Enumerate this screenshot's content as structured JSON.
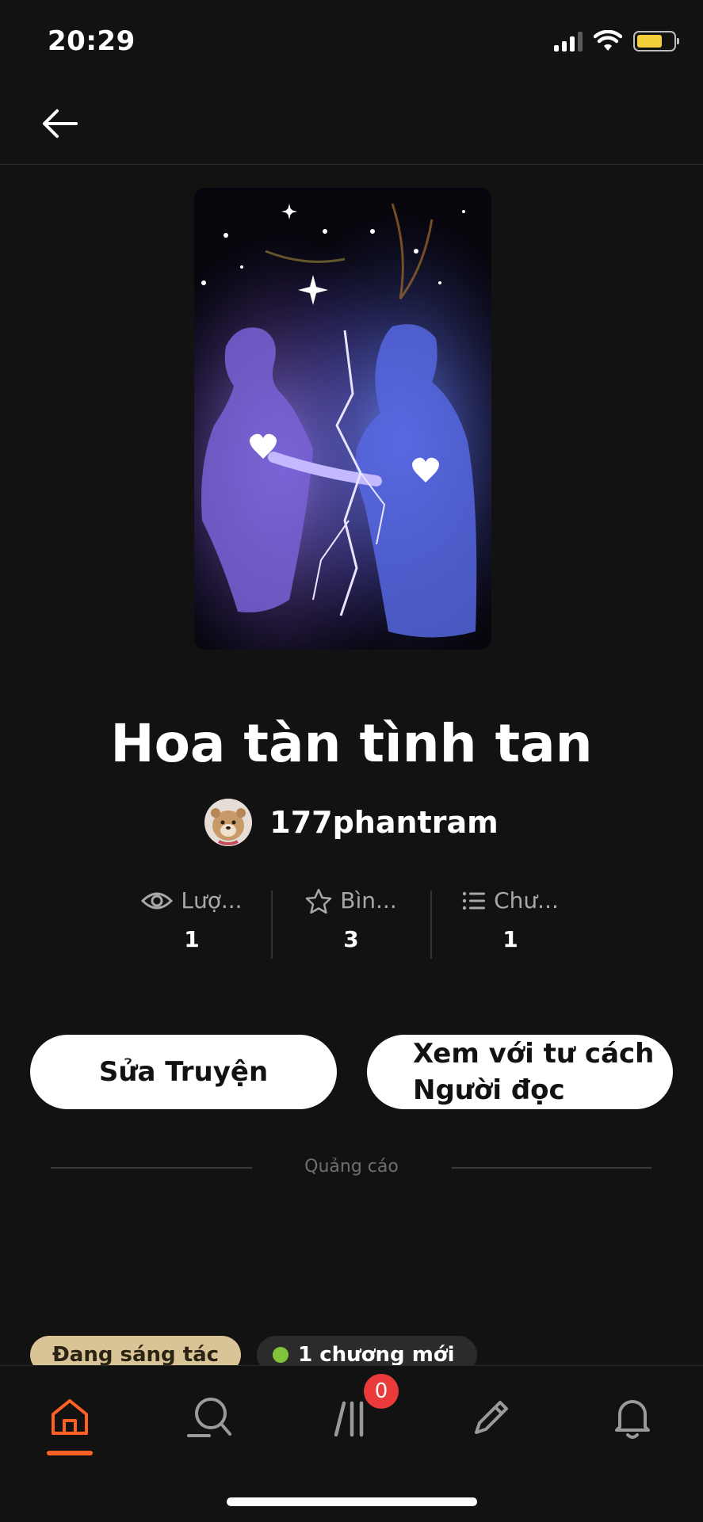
{
  "status_bar": {
    "time": "20:29"
  },
  "story": {
    "title": "Hoa tàn tình tan",
    "author": "177phantram"
  },
  "stats": [
    {
      "icon": "eye-icon",
      "label": "Lượ...",
      "value": "1"
    },
    {
      "icon": "star-icon",
      "label": "Bìn...",
      "value": "3"
    },
    {
      "icon": "list-icon",
      "label": "Chư...",
      "value": "1"
    }
  ],
  "actions": {
    "edit_label": "Sửa Truyện",
    "reader_line1": "Xem với tư cách",
    "reader_line2": "Người đọc"
  },
  "ad_label": "Quảng cáo",
  "chips": {
    "status": "Đang sáng tác",
    "new_chapters": "1 chương mới"
  },
  "nav": {
    "items": [
      "home-icon",
      "search-icon",
      "library-icon",
      "pencil-icon",
      "bell-icon"
    ],
    "active": "home",
    "library_badge": "0"
  },
  "colors": {
    "accent": "#ff6122",
    "badge": "#ea3a3a",
    "chip_status": "#d9c497",
    "new_dot": "#7fc43a"
  }
}
